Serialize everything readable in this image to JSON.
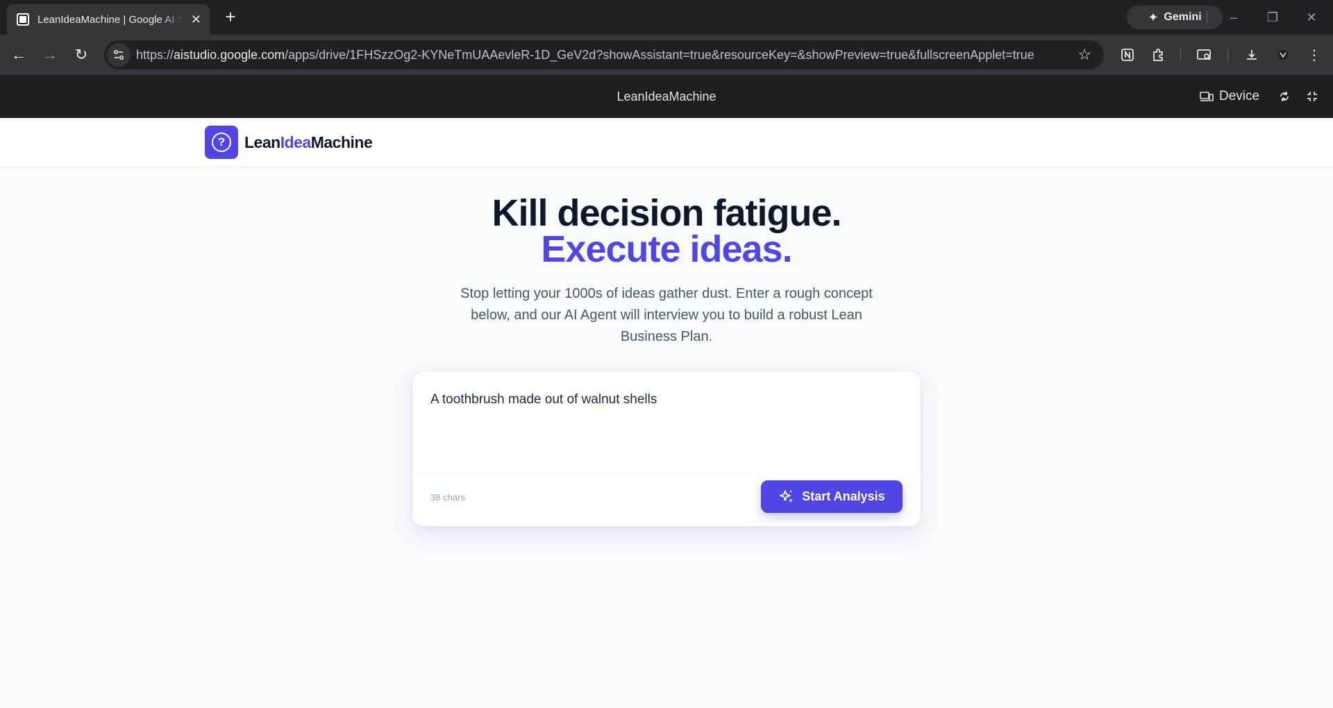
{
  "browser": {
    "tab_title": "LeanIdeaMachine | Google AI Studio",
    "new_tab_label": "+",
    "gemini_label": "Gemini",
    "url_scheme": "https://",
    "url_host": "aistudio.google.com",
    "url_path": "/apps/drive/1FHSzzOg2-KYNeTmUAAevleR-1D_GeV2d?showAssistant=true&resourceKey=&showPreview=true&fullscreenApplet=true"
  },
  "appbar": {
    "title": "LeanIdeaMachine",
    "device_label": "Device"
  },
  "site": {
    "logo_part1": "Lean",
    "logo_part2": "Idea",
    "logo_part3": "Machine"
  },
  "hero": {
    "headline": "Kill decision fatigue.",
    "headline_accent": "Execute ideas.",
    "subtitle": "Stop letting your 1000s of ideas gather dust. Enter a rough concept below, and our AI Agent will interview you to build a robust Lean Business Plan."
  },
  "idea_form": {
    "value": "A toothbrush made out of walnut shells",
    "char_count": "38 chars",
    "submit_label": "Start Analysis"
  },
  "colors": {
    "brand": "#4f46e5",
    "headline": "#0f172a"
  }
}
